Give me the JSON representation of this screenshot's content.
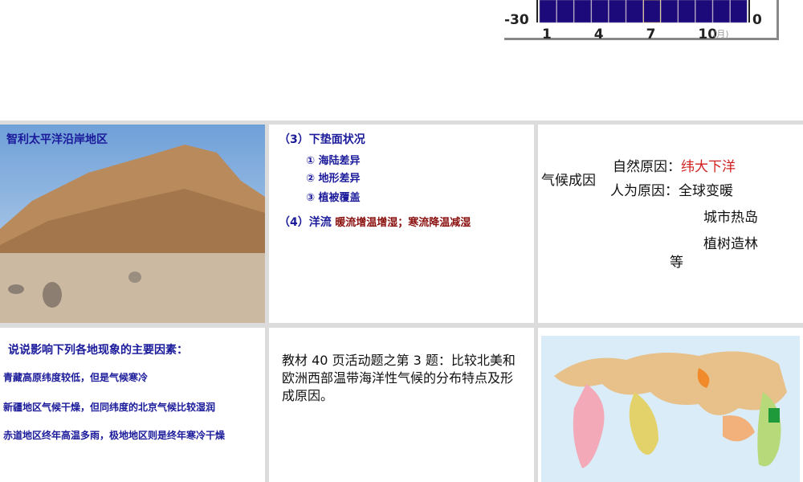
{
  "chart_data": {
    "type": "bar",
    "categories": [
      "1",
      "2",
      "3",
      "4",
      "5",
      "6",
      "7",
      "8",
      "9",
      "10",
      "11",
      "12"
    ],
    "y_left_tick": "-30",
    "y_right_tick": "0",
    "x_ticks": [
      "1",
      "4",
      "7",
      "10"
    ],
    "x_unit": "(月)",
    "bar_color": "#1c0a7a"
  },
  "photo": {
    "caption": "智利太平洋沿岸地区"
  },
  "factors": {
    "item3": "（3）下垫面状况",
    "sub1": "① 海陆差异",
    "sub2": "② 地形差异",
    "sub3": "③ 植被覆盖",
    "item4": "（4）洋流",
    "item4_detail": "暖流增温增湿；寒流降温减湿"
  },
  "causes": {
    "label": "气候成因",
    "natural": "自然原因：",
    "natural_detail": "纬大下洋",
    "human": "人为原因：全球变暖",
    "h2": "城市热岛",
    "h3": "植树造林",
    "etc": "等"
  },
  "questions": {
    "title": "说说影响下列各地现象的主要因素：",
    "q1": "青藏高原纬度较低，但是气候寒冷",
    "q2": "新疆地区气候干燥，但同纬度的北京气候比较湿润",
    "q3": "赤道地区终年高温多雨，极地地区则是终年寒冷干燥"
  },
  "task": {
    "text": "教材 40 页活动题之第 3 题：比较北美和欧洲西部温带海洋性气候的分布特点及形成原因。"
  }
}
